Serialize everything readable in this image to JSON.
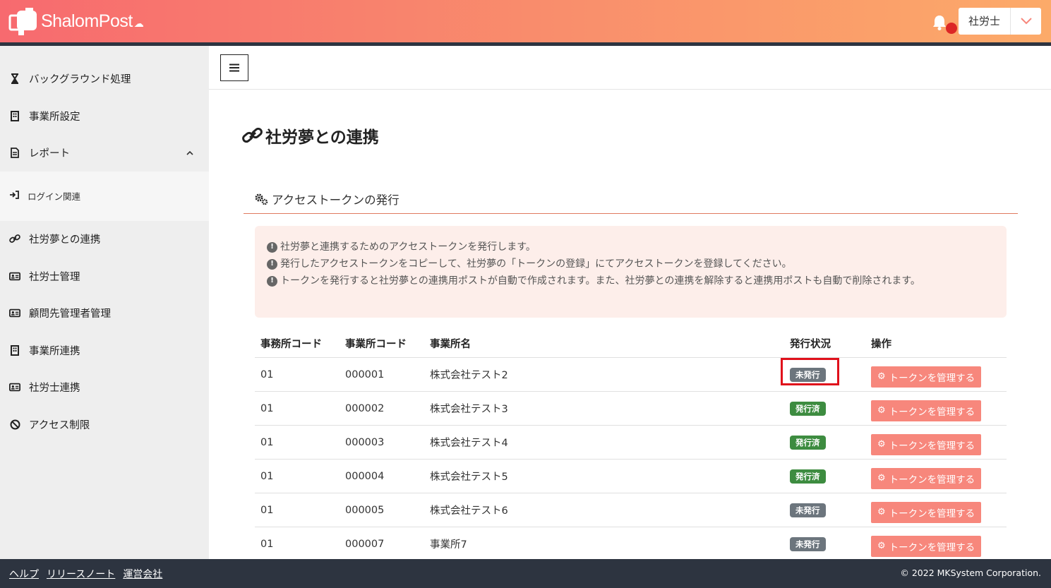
{
  "header": {
    "logo_text": "ShalomPost",
    "user_name": "社労士",
    "brand_color_start": "#f76a6f",
    "brand_color_end": "#fcaa69"
  },
  "sidebar": {
    "items": [
      {
        "label": "バックグラウンド処理",
        "icon": "hourglass-icon"
      },
      {
        "label": "事業所設定",
        "icon": "building-icon"
      },
      {
        "label": "レポート",
        "icon": "document-icon"
      },
      {
        "label": "社労夢との連携",
        "icon": "link-icon"
      },
      {
        "label": "社労士管理",
        "icon": "id-card-icon"
      },
      {
        "label": "顧問先管理者管理",
        "icon": "id-card-icon"
      },
      {
        "label": "事業所連携",
        "icon": "building-icon"
      },
      {
        "label": "社労士連携",
        "icon": "id-card-icon"
      },
      {
        "label": "アクセス制限",
        "icon": "ban-icon"
      }
    ],
    "sub_items": [
      {
        "label": "ログイン関連",
        "icon": "sign-in-icon"
      }
    ]
  },
  "main": {
    "page_title": "社労夢との連携",
    "section_title": "アクセストークンの発行",
    "notices": [
      "社労夢と連携するためのアクセストークンを発行します。",
      "発行したアクセストークンをコピーして、社労夢の「トークンの登録」にてアクセストークンを登録してください。",
      "トークンを発行すると社労夢との連携用ポストが自動で作成されます。また、社労夢との連携を解除すると連携用ポストも自動で削除されます。"
    ],
    "table": {
      "headers": [
        "事務所コード",
        "事業所コード",
        "事業所名",
        "発行状況",
        "操作"
      ],
      "rows": [
        {
          "office_code": "01",
          "site_code": "000001",
          "site_name": "株式会社テスト2",
          "status": "未発行",
          "action": "トークンを管理する"
        },
        {
          "office_code": "01",
          "site_code": "000002",
          "site_name": "株式会社テスト3",
          "status": "発行済",
          "action": "トークンを管理する"
        },
        {
          "office_code": "01",
          "site_code": "000003",
          "site_name": "株式会社テスト4",
          "status": "発行済",
          "action": "トークンを管理する"
        },
        {
          "office_code": "01",
          "site_code": "000004",
          "site_name": "株式会社テスト5",
          "status": "発行済",
          "action": "トークンを管理する"
        },
        {
          "office_code": "01",
          "site_code": "000005",
          "site_name": "株式会社テスト6",
          "status": "未発行",
          "action": "トークンを管理する"
        },
        {
          "office_code": "01",
          "site_code": "000007",
          "site_name": "事業所7",
          "status": "未発行",
          "action": "トークンを管理する"
        }
      ]
    }
  },
  "footer": {
    "links": [
      "ヘルプ",
      "リリースノート",
      "運営会社"
    ],
    "copyright": "© 2022 MKSystem Corporation."
  }
}
